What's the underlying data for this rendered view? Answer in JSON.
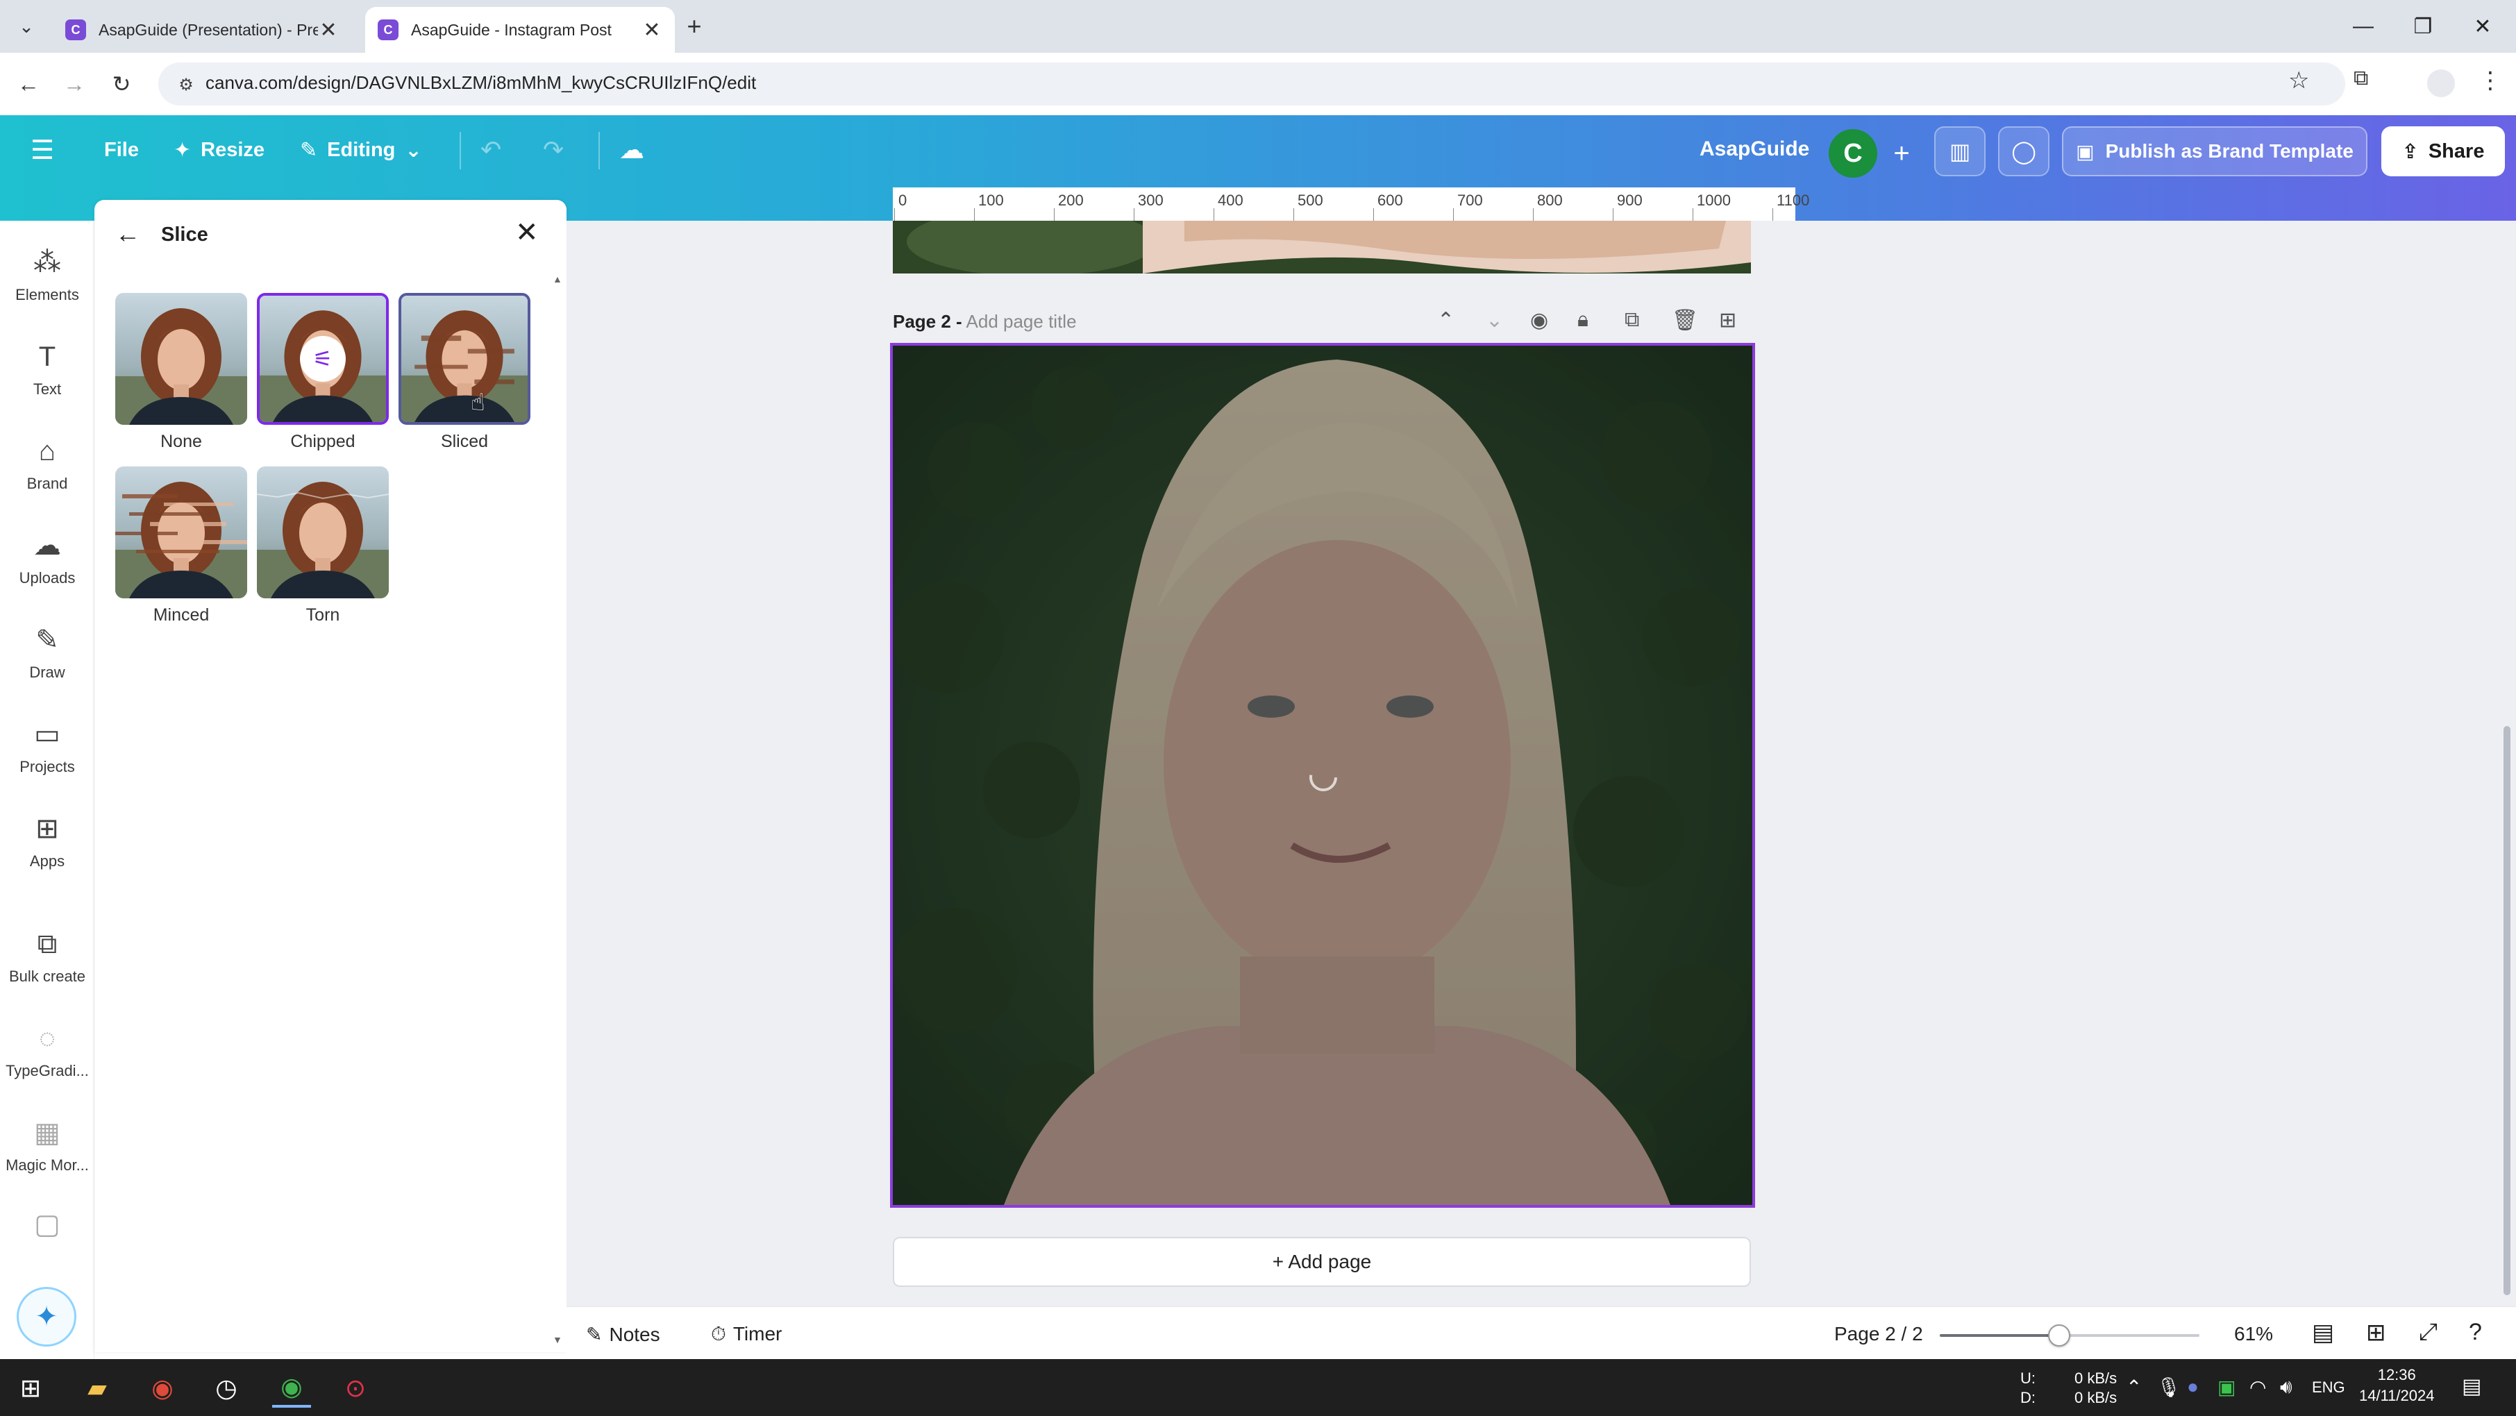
{
  "browser": {
    "tabs": [
      {
        "title": "AsapGuide (Presentation) - Pre",
        "close": "✕"
      },
      {
        "title": "AsapGuide - Instagram Post",
        "close": "✕"
      }
    ],
    "new_tab": "+",
    "url": "canva.com/design/DAGVNLBxLZM/i8mMhM_kwyCsCRUIlzIFnQ/edit"
  },
  "header": {
    "file": "File",
    "resize": "Resize",
    "editing": "Editing",
    "team_name": "AsapGuide",
    "avatar_letter": "C",
    "add": "+",
    "publish": "Publish as Brand Template",
    "share": "Share"
  },
  "rail": {
    "items": [
      {
        "label": "Elements"
      },
      {
        "label": "Text"
      },
      {
        "label": "Brand"
      },
      {
        "label": "Uploads"
      },
      {
        "label": "Draw"
      },
      {
        "label": "Projects"
      },
      {
        "label": "Apps"
      },
      {
        "label": "Bulk create"
      },
      {
        "label": "TypeGradi..."
      },
      {
        "label": "Magic Mor..."
      }
    ]
  },
  "panel": {
    "title": "Slice",
    "options": [
      {
        "label": "None"
      },
      {
        "label": "Chipped"
      },
      {
        "label": "Sliced"
      },
      {
        "label": "Minced"
      },
      {
        "label": "Torn"
      }
    ]
  },
  "canvas": {
    "ruler_ticks": [
      "0",
      "100",
      "200",
      "300",
      "400",
      "500",
      "600",
      "700",
      "800",
      "900",
      "1000",
      "1100"
    ],
    "page_label": "Page 2 -",
    "page_title_placeholder": "Add page title",
    "add_page": "+ Add page"
  },
  "bottom": {
    "notes": "Notes",
    "timer": "Timer",
    "page_counter": "Page 2 / 2",
    "zoom": "61%",
    "zoom_fraction": 0.46
  },
  "taskbar": {
    "net_up_label": "U:",
    "net_down_label": "D:",
    "net_up": "0 kB/s",
    "net_down": "0 kB/s",
    "lang": "ENG",
    "time": "12:36",
    "date": "14/11/2024"
  }
}
